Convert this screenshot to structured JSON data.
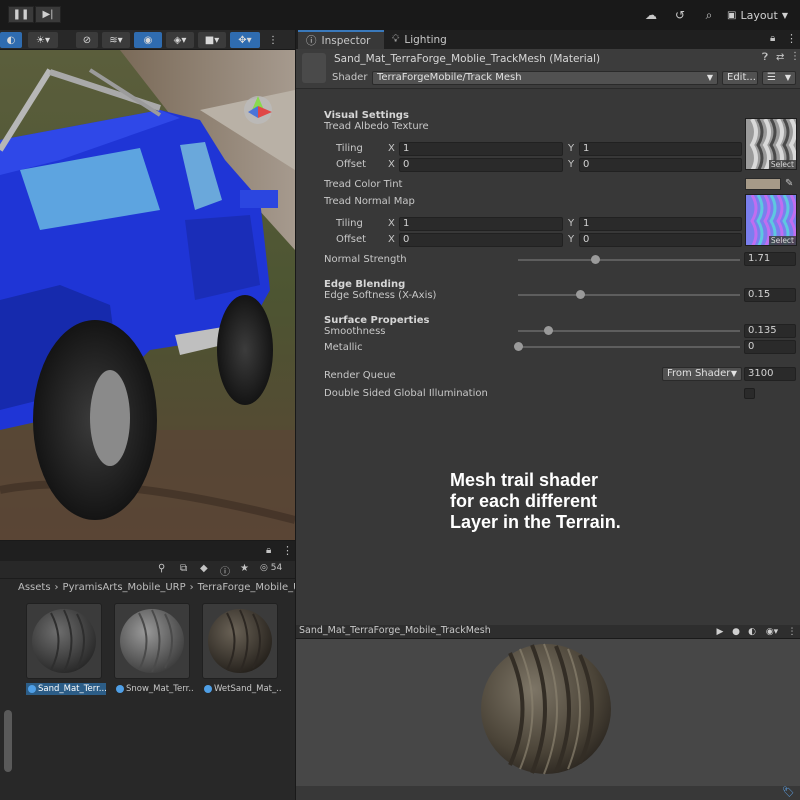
{
  "toolbar": {
    "layout_label": "Layout",
    "icons": [
      "pause-icon",
      "step-icon",
      "cloud-icon",
      "history-icon",
      "search-icon",
      "layout-icon"
    ]
  },
  "scene": {
    "toolbar_icons": [
      "orbit-icon",
      "light-icon",
      "draw-mode-icon",
      "layers-icon",
      "visibility-icon",
      "effects-icon",
      "camera-icon",
      "gizmo-icon"
    ]
  },
  "project": {
    "hidden_count": "54",
    "breadcrumb": [
      "Assets",
      "PyramisArts_Mobile_URP",
      "TerraForge_Mobile_UR"
    ],
    "assets": [
      {
        "label": "Sand_Mat_Terr...",
        "selected": true
      },
      {
        "label": "Snow_Mat_Terr...",
        "selected": false
      },
      {
        "label": "WetSand_Mat_...",
        "selected": false
      }
    ]
  },
  "inspector": {
    "tabs": [
      {
        "label": "Inspector",
        "icon": "info-icon"
      },
      {
        "label": "Lighting",
        "icon": "lightbulb-icon"
      }
    ],
    "material_title": "Sand_Mat_TerraForge_Moblie_TrackMesh (Material)",
    "shader_label": "Shader",
    "shader_value": "TerraForgeMobile/Track Mesh",
    "edit_label": "Edit...",
    "sections": {
      "visual_settings": "Visual Settings",
      "tread_albedo": "Tread Albedo Texture",
      "tiling": "Tiling",
      "offset": "Offset",
      "x": "X",
      "y": "Y",
      "albedo_tiling_x": "1",
      "albedo_tiling_y": "1",
      "albedo_offset_x": "0",
      "albedo_offset_y": "0",
      "select": "Select",
      "tread_color_tint": "Tread Color Tint",
      "tread_normal": "Tread Normal Map",
      "normal_tiling_x": "1",
      "normal_tiling_y": "1",
      "normal_offset_x": "0",
      "normal_offset_y": "0",
      "normal_strength": "Normal Strength",
      "normal_strength_value": "1.71",
      "edge_blending": "Edge Blending",
      "edge_softness": "Edge Softness (X-Axis)",
      "edge_softness_value": "0.15",
      "surface_properties": "Surface Properties",
      "smoothness": "Smoothness",
      "smoothness_value": "0.135",
      "metallic": "Metallic",
      "metallic_value": "0",
      "render_queue": "Render Queue",
      "render_queue_mode": "From Shader",
      "render_queue_value": "3100",
      "double_sided_gi": "Double Sided Global Illumination"
    },
    "slider_levels": {
      "normal_strength": 0.345,
      "edge_softness": 0.28,
      "smoothness": 0.135,
      "metallic": 0.0
    },
    "tint_color": "#a69a88"
  },
  "caption": {
    "line1": "Mesh trail shader",
    "line2": "for each different",
    "line3": "Layer in the Terrain."
  },
  "preview": {
    "title": "Sand_Mat_TerraForge_Mobile_TrackMesh"
  },
  "colors": {
    "accent": "#3a79bb",
    "truck_blue": "#1f35d6"
  }
}
